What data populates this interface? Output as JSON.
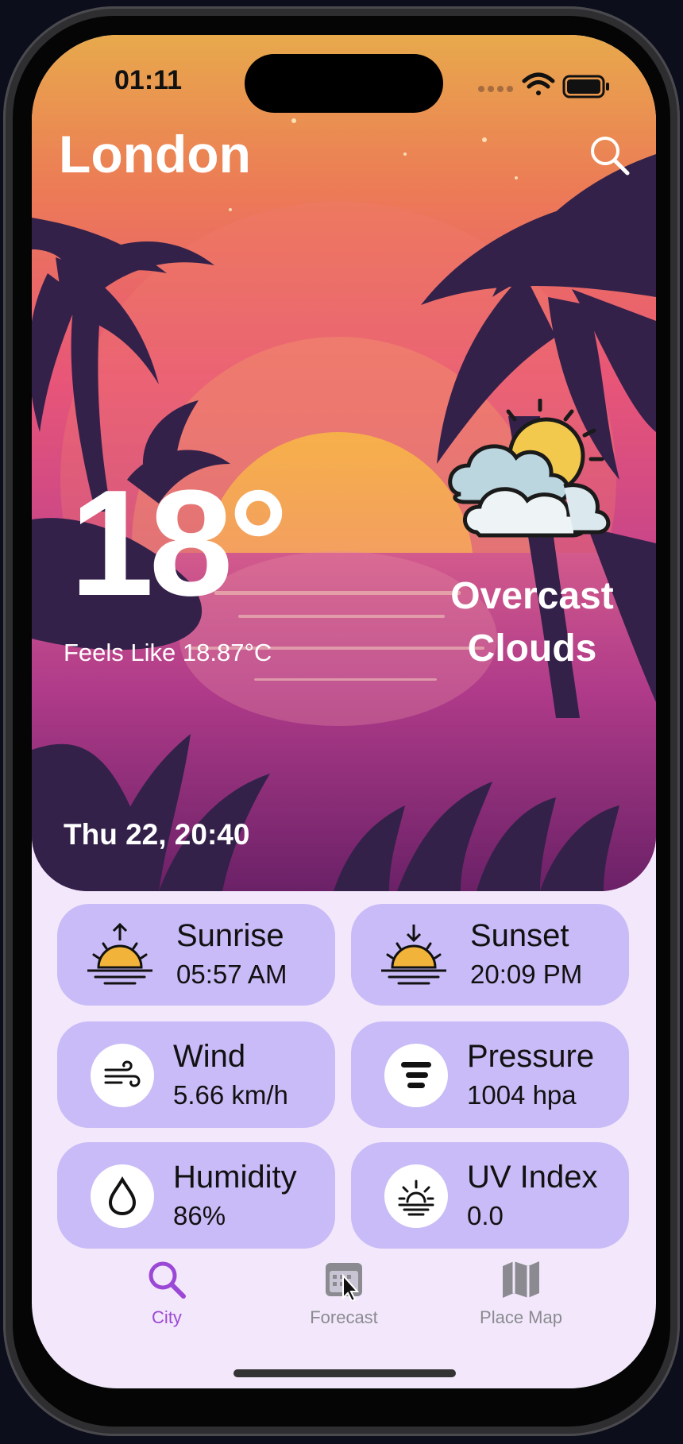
{
  "status": {
    "time": "01:11"
  },
  "weather": {
    "city": "London",
    "temperature": "18°",
    "feels_like": "Feels Like 18.87°C",
    "condition": "Overcast Clouds",
    "datetime": "Thu 22, 20:40"
  },
  "cards": [
    {
      "title": "Sunrise",
      "value": "05:57 AM",
      "icon": "sunrise-icon"
    },
    {
      "title": "Sunset",
      "value": "20:09 PM",
      "icon": "sunset-icon"
    },
    {
      "title": "Wind",
      "value": "5.66 km/h",
      "icon": "wind-icon"
    },
    {
      "title": "Pressure",
      "value": "1004 hpa",
      "icon": "pressure-icon"
    },
    {
      "title": "Humidity",
      "value": "86%",
      "icon": "humidity-icon"
    },
    {
      "title": "UV Index",
      "value": "0.0",
      "icon": "uv-index-icon"
    }
  ],
  "nav": {
    "items": [
      {
        "label": "City",
        "icon": "search-icon",
        "active": true
      },
      {
        "label": "Forecast",
        "icon": "calendar-icon",
        "active": false
      },
      {
        "label": "Place Map",
        "icon": "map-icon",
        "active": false
      }
    ]
  },
  "colors": {
    "accent": "#9b48d6",
    "card": "#c9bbf7",
    "background": "#f3e8fb"
  }
}
